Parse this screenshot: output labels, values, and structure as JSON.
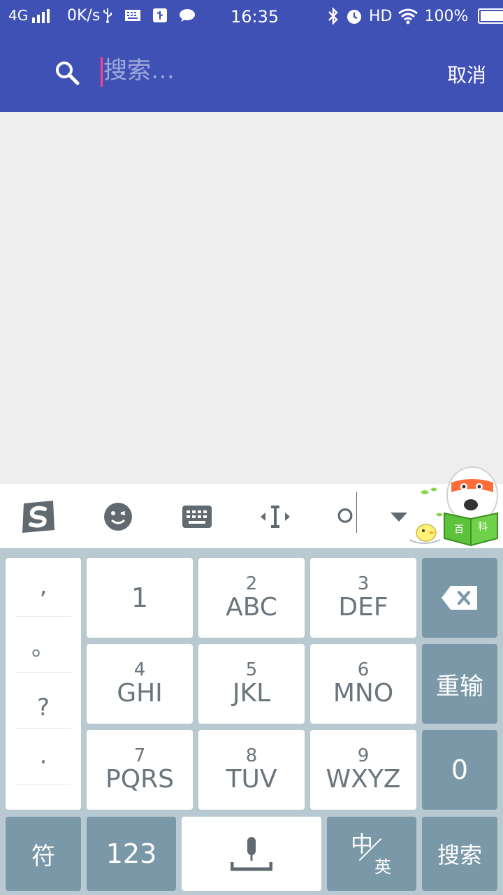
{
  "status_bar": {
    "network": "4G",
    "speed": "0K/s",
    "time": "16:35",
    "hd": "HD",
    "battery": "100%"
  },
  "search": {
    "placeholder": "搜索…",
    "value": "",
    "cancel_label": "取消"
  },
  "keyboard": {
    "punctuation": [
      ",",
      "。",
      "?",
      "·"
    ],
    "keys": [
      {
        "num": "",
        "letters": "1"
      },
      {
        "num": "2",
        "letters": "ABC"
      },
      {
        "num": "3",
        "letters": "DEF"
      },
      {
        "num": "4",
        "letters": "GHI"
      },
      {
        "num": "5",
        "letters": "JKL"
      },
      {
        "num": "6",
        "letters": "MNO"
      },
      {
        "num": "7",
        "letters": "PQRS"
      },
      {
        "num": "8",
        "letters": "TUV"
      },
      {
        "num": "9",
        "letters": "WXYZ"
      }
    ],
    "retype_label": "重输",
    "zero_label": "0",
    "symbol_label": "符",
    "numeric_label": "123",
    "lang_zh": "中",
    "lang_en": "英",
    "search_label": "搜索"
  },
  "mascot": {
    "book_left": "百",
    "book_right": "科"
  },
  "colors": {
    "app_bar": "#3f51b5",
    "caret": "#ff4081",
    "keyboard_bg": "#b9c9d2",
    "function_key": "#7a98a8"
  }
}
